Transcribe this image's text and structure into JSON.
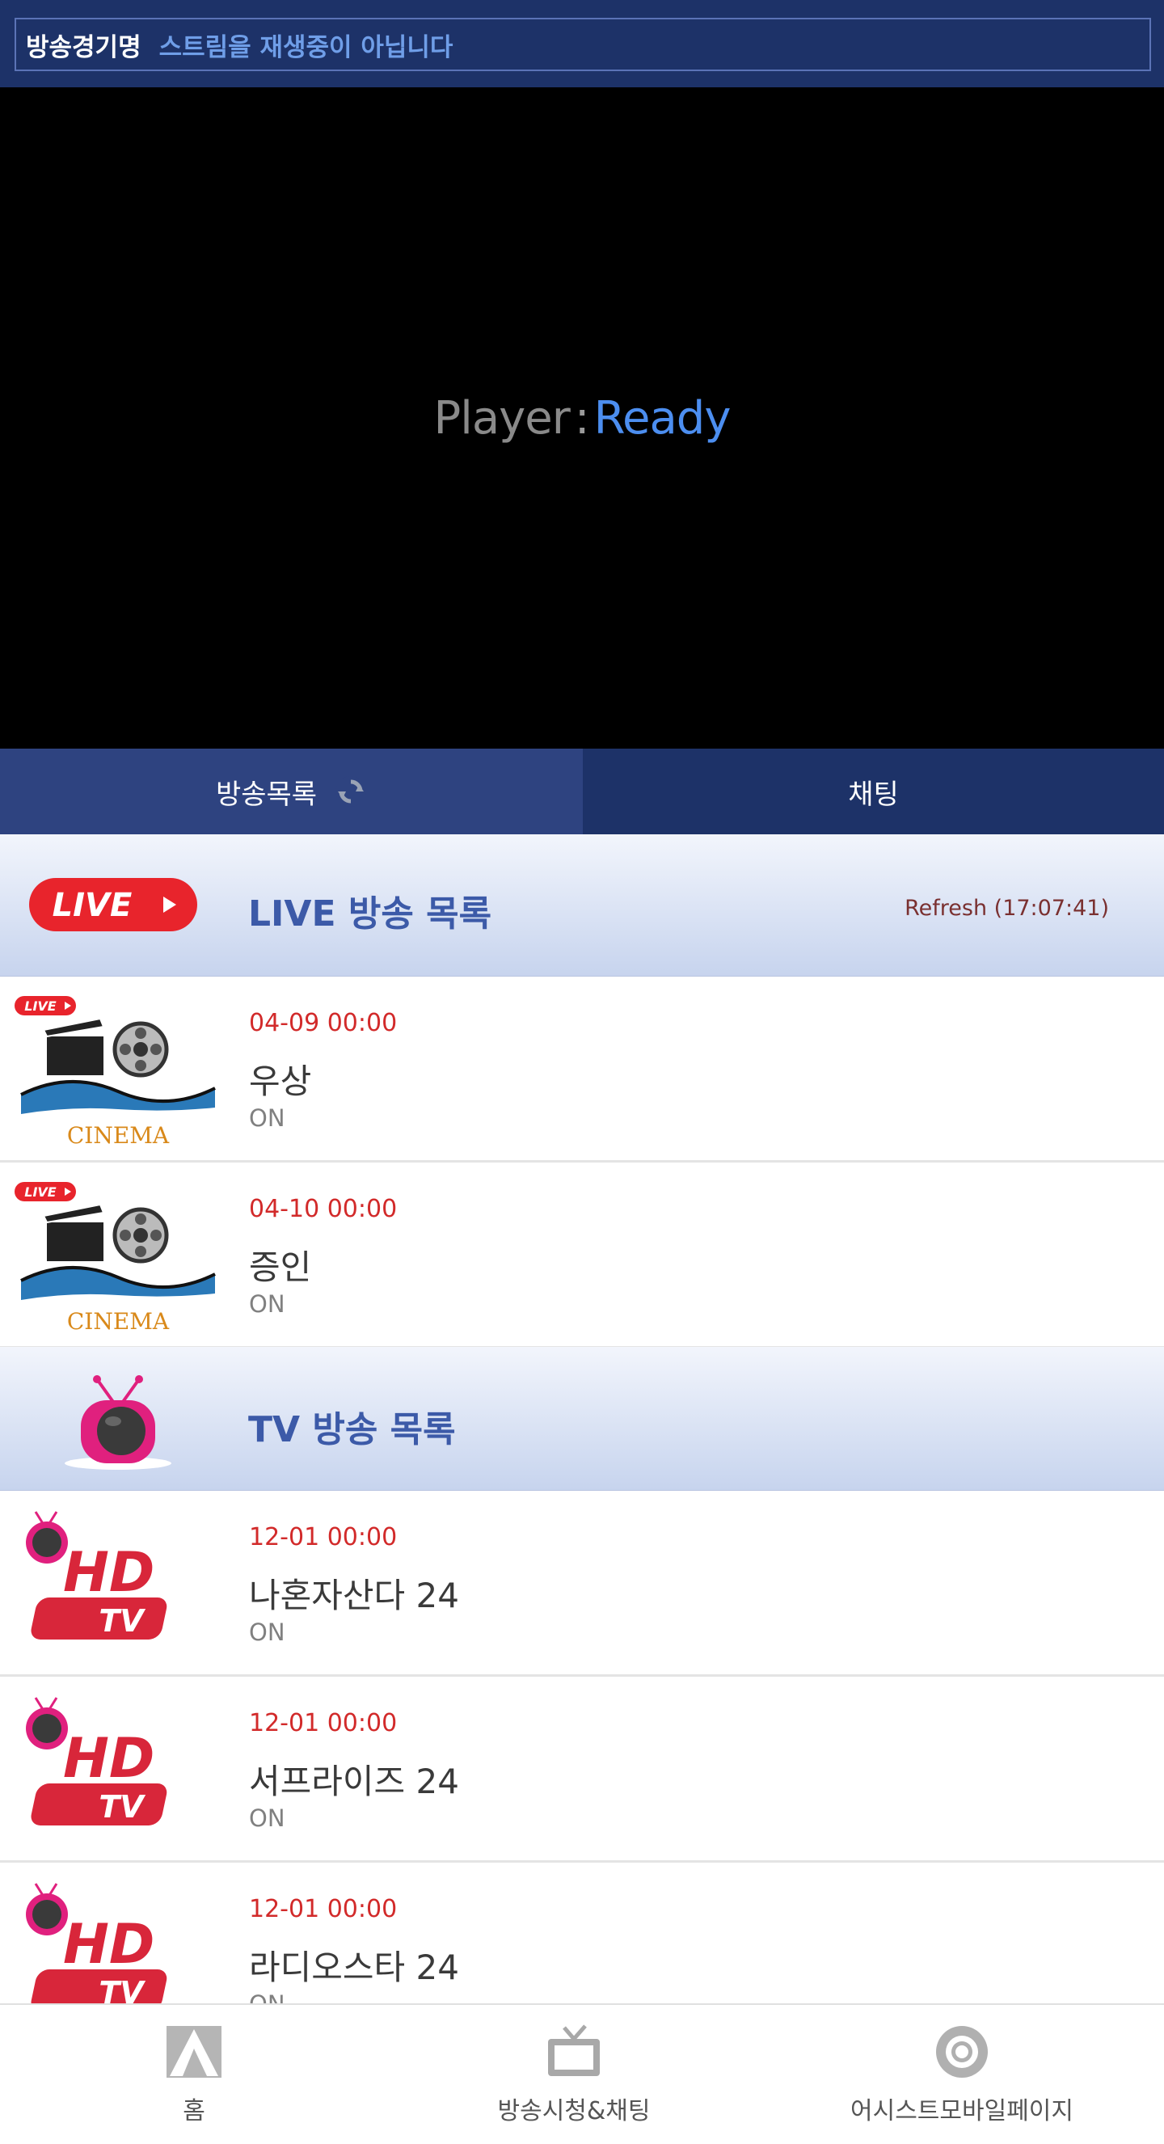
{
  "topbar": {
    "title": "방송경기명",
    "status": "스트림을 재생중이 아닙니다"
  },
  "player": {
    "label": "Player",
    "separator": ":",
    "state": "Ready"
  },
  "tabs": {
    "list_label": "방송목록",
    "chat_label": "채팅"
  },
  "live_section": {
    "badge": "LIVE",
    "title": "LIVE 방송 목록",
    "refresh": "Refresh (17:07:41)",
    "items": [
      {
        "date": "04-09 00:00",
        "title": "우상",
        "status": "ON",
        "thumb_badge": "LIVE",
        "thumb_caption": "CINEMA"
      },
      {
        "date": "04-10 00:00",
        "title": "증인",
        "status": "ON",
        "thumb_badge": "LIVE",
        "thumb_caption": "CINEMA"
      }
    ]
  },
  "tv_section": {
    "title": "TV 방송 목록",
    "items": [
      {
        "date": "12-01 00:00",
        "title": "나혼자산다 24",
        "status": "ON",
        "thumb_line1": "HD",
        "thumb_line2": "TV"
      },
      {
        "date": "12-01 00:00",
        "title": "서프라이즈 24",
        "status": "ON",
        "thumb_line1": "HD",
        "thumb_line2": "TV"
      },
      {
        "date": "12-01 00:00",
        "title": "라디오스타 24",
        "status": "ON",
        "thumb_line1": "HD",
        "thumb_line2": "TV"
      }
    ]
  },
  "bottom_nav": {
    "home": "홈",
    "watch": "방송시청&채팅",
    "assist": "어시스트모바일페이지"
  },
  "colors": {
    "topbar": "#1d3268",
    "tab_active": "#2e4380",
    "live_red": "#e8242c",
    "date_red": "#d22a2a",
    "section_title": "#3c5aa8",
    "tv_pink": "#e0207e"
  }
}
